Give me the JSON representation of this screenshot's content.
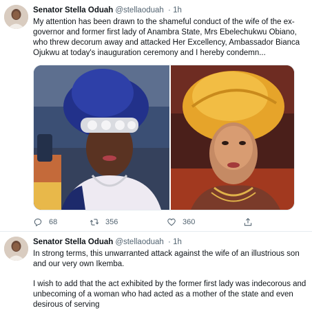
{
  "tweets": [
    {
      "author": {
        "name": "Senator Stella Oduah",
        "handle": "@stellaoduah",
        "separator": "·",
        "time": "1h"
      },
      "text": "My attention has been drawn to the shameful conduct of the wife of the ex-governor and former first lady of Anambra State, Mrs Ebelechukwu Obiano, who threw decorum away and attacked Her Excellency, Ambassador Bianca Ojukwu at today's inauguration ceremony and I hereby condemn...",
      "actions": {
        "reply_count": "68",
        "retweet_count": "356",
        "like_count": "360"
      }
    },
    {
      "author": {
        "name": "Senator Stella Oduah",
        "handle": "@stellaoduah",
        "separator": "·",
        "time": "1h"
      },
      "paragraphs": [
        "In strong terms, this unwarranted attack against the wife of an illustrious son and our very own Ikemba.",
        "I wish to add that the act exhibited by the former first lady was indecorous and unbecoming of a woman who had acted as a mother of the state and even desirous of serving"
      ]
    }
  ],
  "icons": {
    "reply": "reply-icon",
    "retweet": "retweet-icon",
    "like": "heart-icon",
    "share": "share-icon"
  },
  "colors": {
    "text": "#0f1419",
    "muted": "#536471",
    "divider": "#e6ecf0"
  }
}
